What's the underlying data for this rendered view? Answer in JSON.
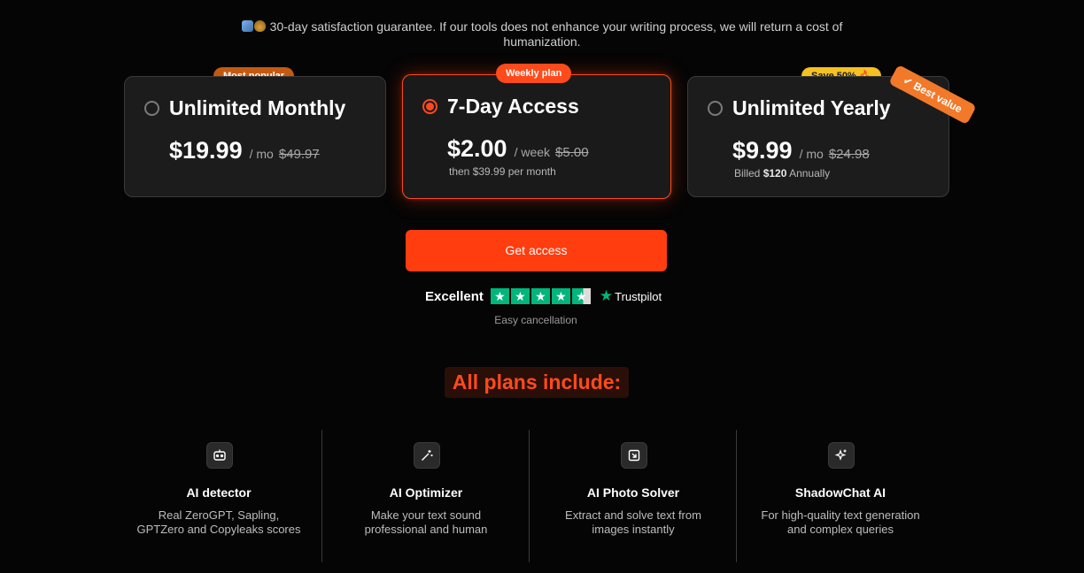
{
  "guarantee": {
    "icons": [
      "refresh-emoji",
      "money-bag-emoji"
    ],
    "text": "30-day satisfaction guarantee. If our tools does not enhance your writing process, we will return a cost of humanization."
  },
  "plans": [
    {
      "badge": "Most popular",
      "name": "Unlimited Monthly",
      "price": "$19.99",
      "period": "/ mo",
      "old_price": "$49.97",
      "selected": false
    },
    {
      "badge": "Weekly plan",
      "name": "7-Day Access",
      "price": "$2.00",
      "period": "/ week",
      "old_price": "$5.00",
      "note": "then $39.99 per month",
      "selected": true
    },
    {
      "badge": "Save 50% 🔥",
      "ribbon": "✔ Best value",
      "name": "Unlimited Yearly",
      "price": "$9.99",
      "period": "/ mo",
      "old_price": "$24.98",
      "note_prefix": "Billed",
      "note_amount": "$120",
      "note_suffix": "Annually",
      "selected": false
    }
  ],
  "cta": {
    "label": "Get access"
  },
  "rating": {
    "label": "Excellent",
    "stars": 4.5,
    "provider": "Trustpilot"
  },
  "cancellation": "Easy cancellation",
  "includes_heading": "All plans include:",
  "features": [
    {
      "icon": "robot-icon",
      "title": "AI detector",
      "desc": "Real ZeroGPT, Sapling, GPTZero and Copyleaks scores"
    },
    {
      "icon": "magic-wand-icon",
      "title": "AI Optimizer",
      "desc": "Make your text sound professional and human"
    },
    {
      "icon": "image-icon",
      "title": "AI Photo Solver",
      "desc": "Extract and solve text from images instantly"
    },
    {
      "icon": "sparkles-icon",
      "title": "ShadowChat AI",
      "desc": "For high-quality text generation and complex queries"
    }
  ],
  "colors": {
    "accent": "#ff3d0f",
    "popular_badge": "#c45a12",
    "save_badge": "#f5c022",
    "ribbon": "#f2792a",
    "trustpilot": "#00b67a"
  }
}
